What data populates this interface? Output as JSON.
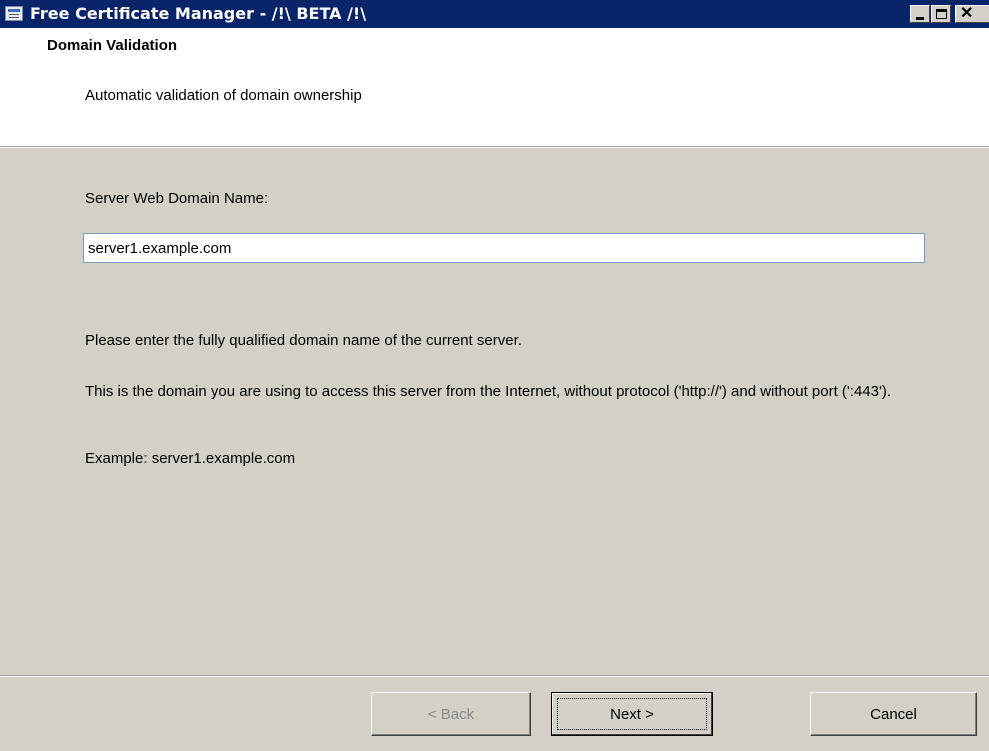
{
  "window": {
    "title": "Free Certificate Manager - /!\\ BETA /!\\",
    "icon": "app-window-icon",
    "controls": {
      "minimize": "minimize-icon",
      "maximize": "maximize-icon",
      "close": "close-icon"
    }
  },
  "header": {
    "title": "Domain Validation",
    "subtitle": "Automatic validation of domain ownership"
  },
  "form": {
    "domain_label": "Server Web Domain Name:",
    "domain_value": "server1.example.com"
  },
  "help": {
    "line1": "Please enter the fully qualified domain name of the current server.",
    "line2": "This is the domain you are using to access this server from the Internet, without protocol ('http://') and without port (':443').",
    "line3": "Example: server1.example.com"
  },
  "buttons": {
    "back": "< Back",
    "next": "Next >",
    "cancel": "Cancel"
  }
}
